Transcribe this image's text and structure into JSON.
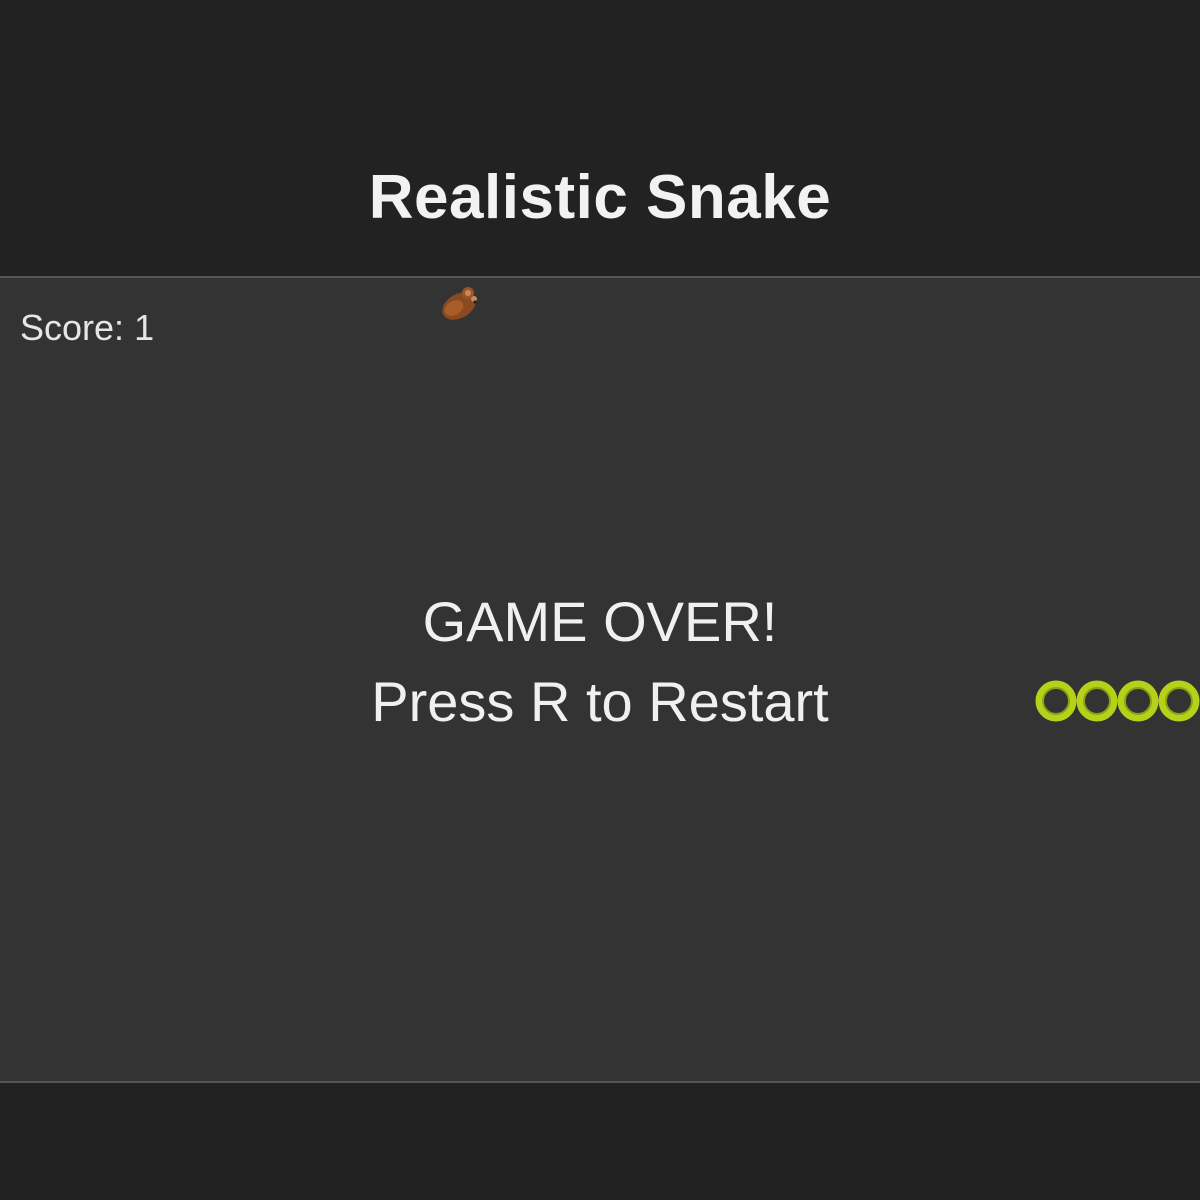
{
  "app": {
    "title": "Realistic Snake"
  },
  "hud": {
    "score_label": "Score:",
    "score_value": "1"
  },
  "overlay": {
    "game_over": "GAME OVER!",
    "restart_hint": "Press R to Restart"
  },
  "game": {
    "state": "game-over",
    "snake_segments": 4,
    "food_icon": "mouse-icon",
    "snake_icon": "snake-segment-icon"
  },
  "colors": {
    "page_bg": "#222222",
    "board_bg": "#333333",
    "board_border": "#555555",
    "text": "#f0f0f0",
    "snake": "#b5d11a",
    "food": "#8a4a20"
  }
}
